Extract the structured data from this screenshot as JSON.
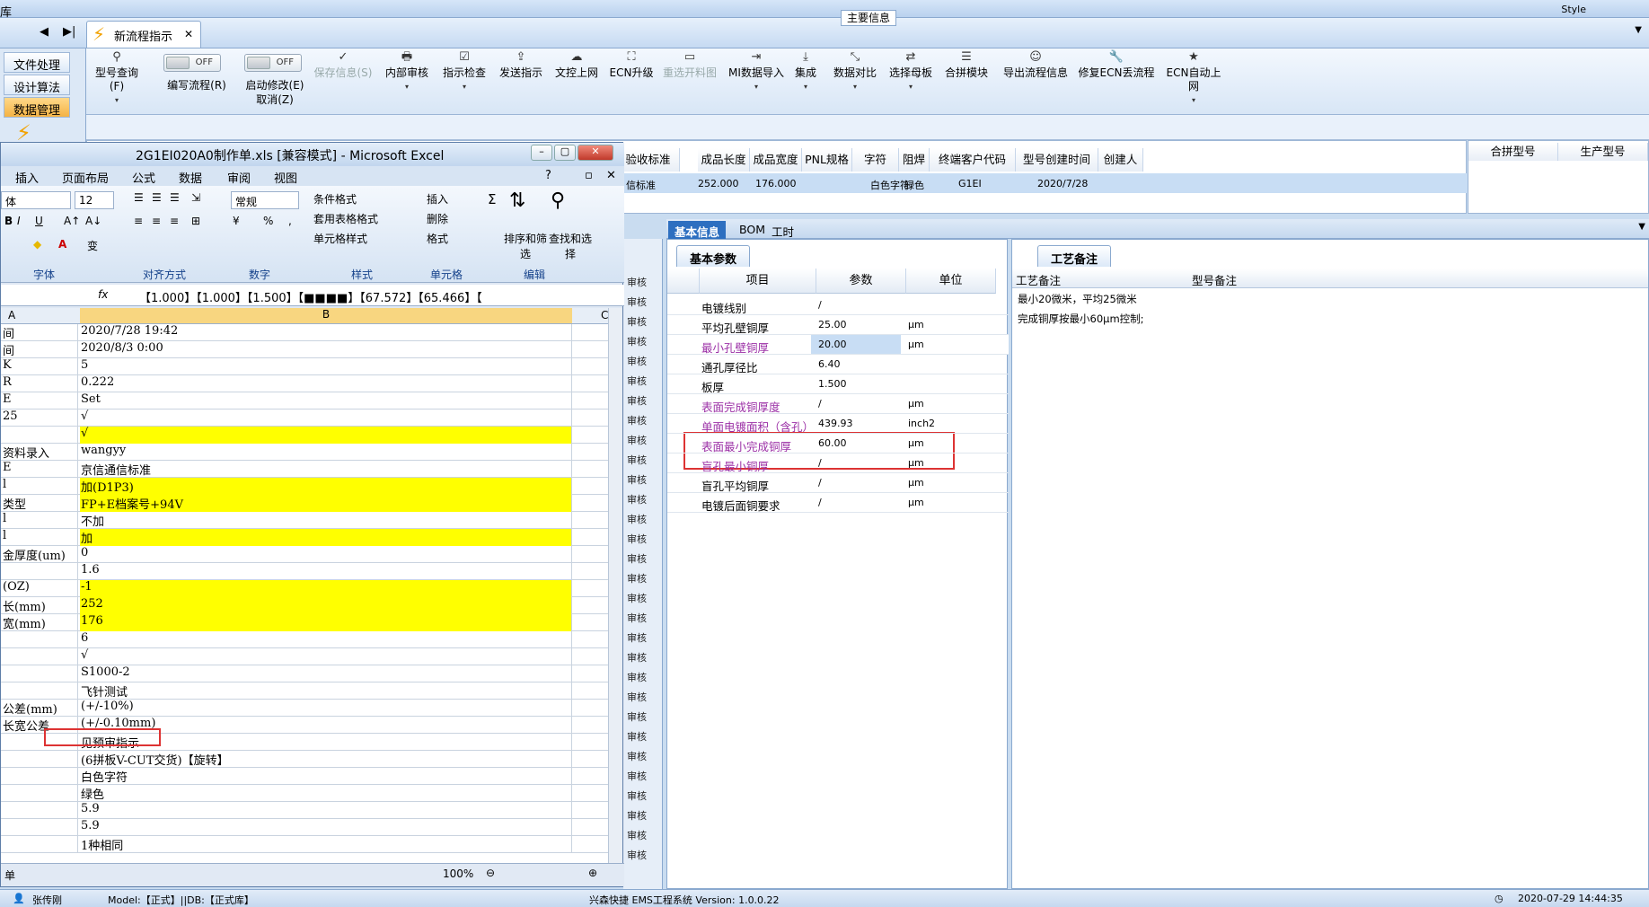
{
  "app": {
    "left_label": "库",
    "style_label": "Style",
    "doc_tab": "新流程指示"
  },
  "left_menu": [
    "文件处理",
    "设计算法",
    "数据管理"
  ],
  "ribbon": {
    "model_query": "型号查询(F)",
    "write_flow": "编写流程(R)",
    "toggle_off": "OFF",
    "start_modify": "启动修改(E)",
    "cancel": "取消(Z)",
    "save_info": "保存信息(S)",
    "items": [
      "内部审核",
      "指示检查",
      "发送指示",
      "文控上网",
      "ECN升级",
      "重选开料图",
      "MI数据导入",
      "集成",
      "数据对比",
      "选择母板",
      "合拼模块",
      "导出流程信息",
      "修复ECN丢流程",
      "ECN自动上网"
    ]
  },
  "main_info": {
    "title": "主要信息",
    "headers": [
      "验收标准",
      "成品长度",
      "成品宽度",
      "PNL规格",
      "字符",
      "阻焊",
      "终端客户代码",
      "型号创建时间",
      "创建人"
    ],
    "row": [
      "信标准",
      "252.000",
      "176.000",
      "",
      "白色字符",
      "绿色",
      "G1EI",
      "2020/7/28",
      ""
    ],
    "merge_headers": [
      "合拼型号",
      "生产型号"
    ]
  },
  "right_tabs": [
    "基本信息",
    "BOM",
    "工时"
  ],
  "basic_params": {
    "tab": "基本参数",
    "headers": [
      "项目",
      "参数",
      "单位"
    ],
    "rows": [
      {
        "item": "电镀线别",
        "value": "/",
        "unit": ""
      },
      {
        "item": "平均孔壁铜厚",
        "value": "25.00",
        "unit": "μm"
      },
      {
        "item": "最小孔壁铜厚",
        "value": "20.00",
        "unit": "μm"
      },
      {
        "item": "通孔厚径比",
        "value": "6.40",
        "unit": ""
      },
      {
        "item": "板厚",
        "value": "1.500",
        "unit": ""
      },
      {
        "item": "表面完成铜厚度",
        "value": "/",
        "unit": "μm"
      },
      {
        "item": "单面电镀面积（含孔）",
        "value": "439.93",
        "unit": "inch2"
      },
      {
        "item": "表面最小完成铜厚",
        "value": "60.00",
        "unit": "μm"
      },
      {
        "item": "盲孔最小铜厚",
        "value": "/",
        "unit": "μm"
      },
      {
        "item": "盲孔平均铜厚",
        "value": "/",
        "unit": "μm"
      },
      {
        "item": "电镀后面铜要求",
        "value": "/",
        "unit": "μm"
      }
    ]
  },
  "process_notes": {
    "tab": "工艺备注",
    "col1": "工艺备注",
    "col2": "型号备注",
    "lines": [
      "最小20微米，平均25微米",
      "完成铜厚按最小60μm控制;"
    ]
  },
  "mid_strip_label": "审核",
  "excel": {
    "title": "2G1EI020A0制作单.xls  [兼容模式] - Microsoft Excel",
    "menu": [
      "插入",
      "页面布局",
      "公式",
      "数据",
      "审阅",
      "视图"
    ],
    "font_name": "体",
    "font_size": "12",
    "number_format": "常规",
    "groups": [
      "字体",
      "对齐方式",
      "数字",
      "样式",
      "单元格",
      "编辑"
    ],
    "style_items": [
      "条件格式",
      "套用表格格式",
      "单元格样式"
    ],
    "cell_items": [
      "插入",
      "删除",
      "格式"
    ],
    "edit_items": [
      "排序和筛选",
      "查找和选择"
    ],
    "formula": "【1.000】【1.000】【1.500】【■■■■】【67.572】【65.466】【",
    "fx": "fx",
    "col_a": "A",
    "col_b": "B",
    "col_c": "C",
    "rows": [
      {
        "a": "间",
        "b": "2020/7/28 19:42",
        "y": false
      },
      {
        "a": "间",
        "b": "2020/8/3 0:00",
        "y": false
      },
      {
        "a": "K",
        "b": "5",
        "y": false
      },
      {
        "a": "R",
        "b": "0.222",
        "y": false
      },
      {
        "a": "E",
        "b": "Set",
        "y": false
      },
      {
        "a": "25",
        "b": "√",
        "y": false
      },
      {
        "a": "",
        "b": "√",
        "y": true
      },
      {
        "a": "资料录入",
        "b": "wangyy",
        "y": false
      },
      {
        "a": "E",
        "b": "京信通信标准",
        "y": false
      },
      {
        "a": "l",
        "b": "加(D1P3)",
        "y": true
      },
      {
        "a": "类型",
        "b": "FP+E档案号+94V",
        "y": true
      },
      {
        "a": "l",
        "b": "不加",
        "y": false
      },
      {
        "a": "l",
        "b": "加",
        "y": true
      },
      {
        "a": "金厚度(um)",
        "b": "0",
        "y": false
      },
      {
        "a": "",
        "b": "1.6",
        "y": false
      },
      {
        "a": "(OZ)",
        "b": "-1",
        "y": true
      },
      {
        "a": "长(mm)",
        "b": "252",
        "y": true
      },
      {
        "a": "宽(mm)",
        "b": "176",
        "y": true
      },
      {
        "a": "",
        "b": "6",
        "y": false
      },
      {
        "a": "",
        "b": "√",
        "y": false
      },
      {
        "a": "",
        "b": "S1000-2",
        "y": false
      },
      {
        "a": "",
        "b": "飞针测试",
        "y": false
      },
      {
        "a": "公差(mm)",
        "b": "(+/-10%)",
        "y": false
      },
      {
        "a": "长宽公差",
        "b": "(+/-0.10mm)",
        "y": false
      },
      {
        "a": "",
        "b": "见预审指示",
        "y": false
      },
      {
        "a": "",
        "b": "(6拼板V-CUT交货)【旋转】",
        "y": false
      },
      {
        "a": "",
        "b": "白色字符",
        "y": false
      },
      {
        "a": "",
        "b": "绿色",
        "y": false
      },
      {
        "a": "",
        "b": "5.9",
        "y": false
      },
      {
        "a": "",
        "b": "5.9",
        "y": false
      },
      {
        "a": "",
        "b": "1种相同",
        "y": false
      }
    ],
    "sheet_tab": "单",
    "zoom": "100%"
  },
  "status": {
    "user": "张传刚",
    "model": "Model:【正式】||DB:【正式库】",
    "system": "兴森快捷 EMS工程系统  Version: 1.0.0.22",
    "datetime": "2020-07-29 14:44:35"
  }
}
